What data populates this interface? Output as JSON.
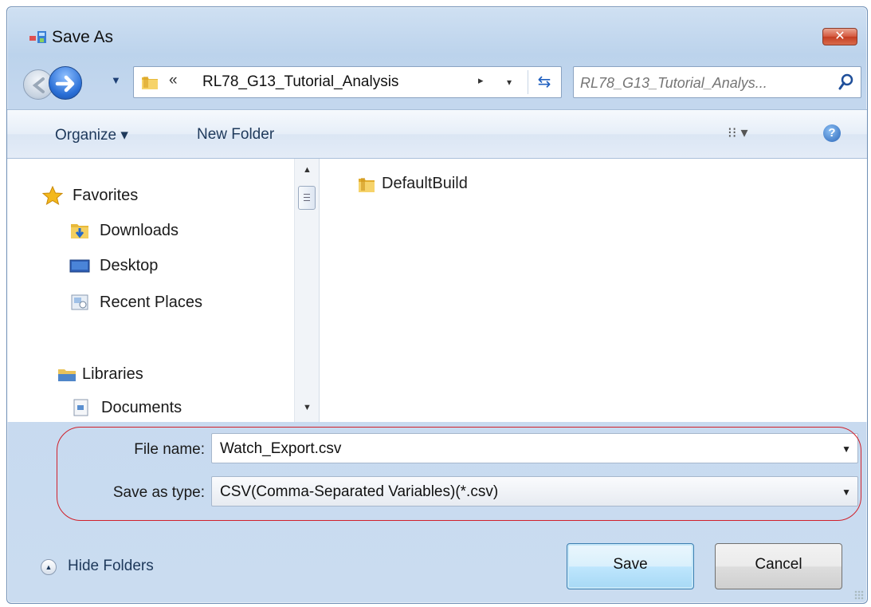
{
  "window": {
    "title": "Save As",
    "close_label": "✕"
  },
  "address_bar": {
    "overflow_chevron": "«",
    "path": "RL78_G13_Tutorial_Analysis",
    "path_arrow": "▸",
    "dropdown": "▾"
  },
  "search": {
    "placeholder": "RL78_G13_Tutorial_Analys..."
  },
  "toolbar": {
    "organize_label": "Organize ▾",
    "new_folder_label": "New Folder",
    "views_label": "⁝⁝ ▾",
    "help_label": "?"
  },
  "nav_pane": {
    "favorites_label": "Favorites",
    "items": [
      {
        "label": "Downloads",
        "icon": "downloads-icon"
      },
      {
        "label": "Desktop",
        "icon": "desktop-icon"
      },
      {
        "label": "Recent Places",
        "icon": "recent-places-icon"
      }
    ],
    "libraries_label": "Libraries",
    "library_items": [
      {
        "label": "Documents",
        "icon": "documents-icon"
      }
    ]
  },
  "files": [
    {
      "label": "DefaultBuild",
      "icon": "folder-icon"
    }
  ],
  "form": {
    "file_name_label": "File name:",
    "file_name_value": "Watch_Export.csv",
    "type_label": "Save as type:",
    "type_value": "CSV(Comma-Separated Variables)(*.csv)"
  },
  "footer": {
    "hide_folders_label": "Hide Folders",
    "save_label": "Save",
    "cancel_label": "Cancel"
  },
  "colors": {
    "highlight": "#d0202a",
    "accent_blue": "#2a6fd6"
  }
}
